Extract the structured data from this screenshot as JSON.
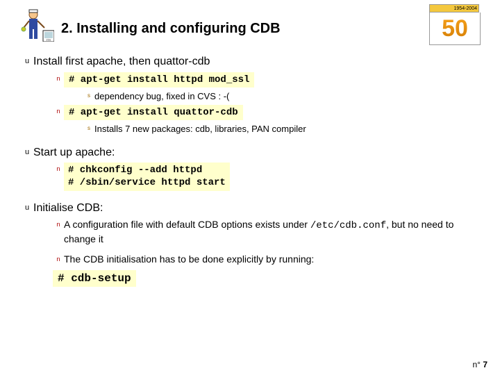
{
  "header": {
    "title": "2. Installing and configuring CDB",
    "logo_year": "1954-2004",
    "logo_number": "50"
  },
  "b1": {
    "text": "Install first apache, then quattor-cdb",
    "code1": "# apt-get install httpd mod_ssl",
    "sub1": "dependency bug, fixed in CVS : -(",
    "code2": "# apt-get install quattor-cdb",
    "sub2": "Installs 7 new packages: cdb, libraries, PAN compiler"
  },
  "b2": {
    "text": "Start up apache:",
    "code": "# chkconfig --add httpd\n# /sbin/service httpd start"
  },
  "b3": {
    "text": "Initialise CDB:",
    "p1a": "A configuration file with default CDB options exists under ",
    "p1b": "/etc/cdb.conf",
    "p1c": ", but no need to change it",
    "p2": "The CDB initialisation has to be done explicitly by running:",
    "code": "# cdb-setup"
  },
  "footer": {
    "prefix": "n°",
    "page": "7"
  }
}
